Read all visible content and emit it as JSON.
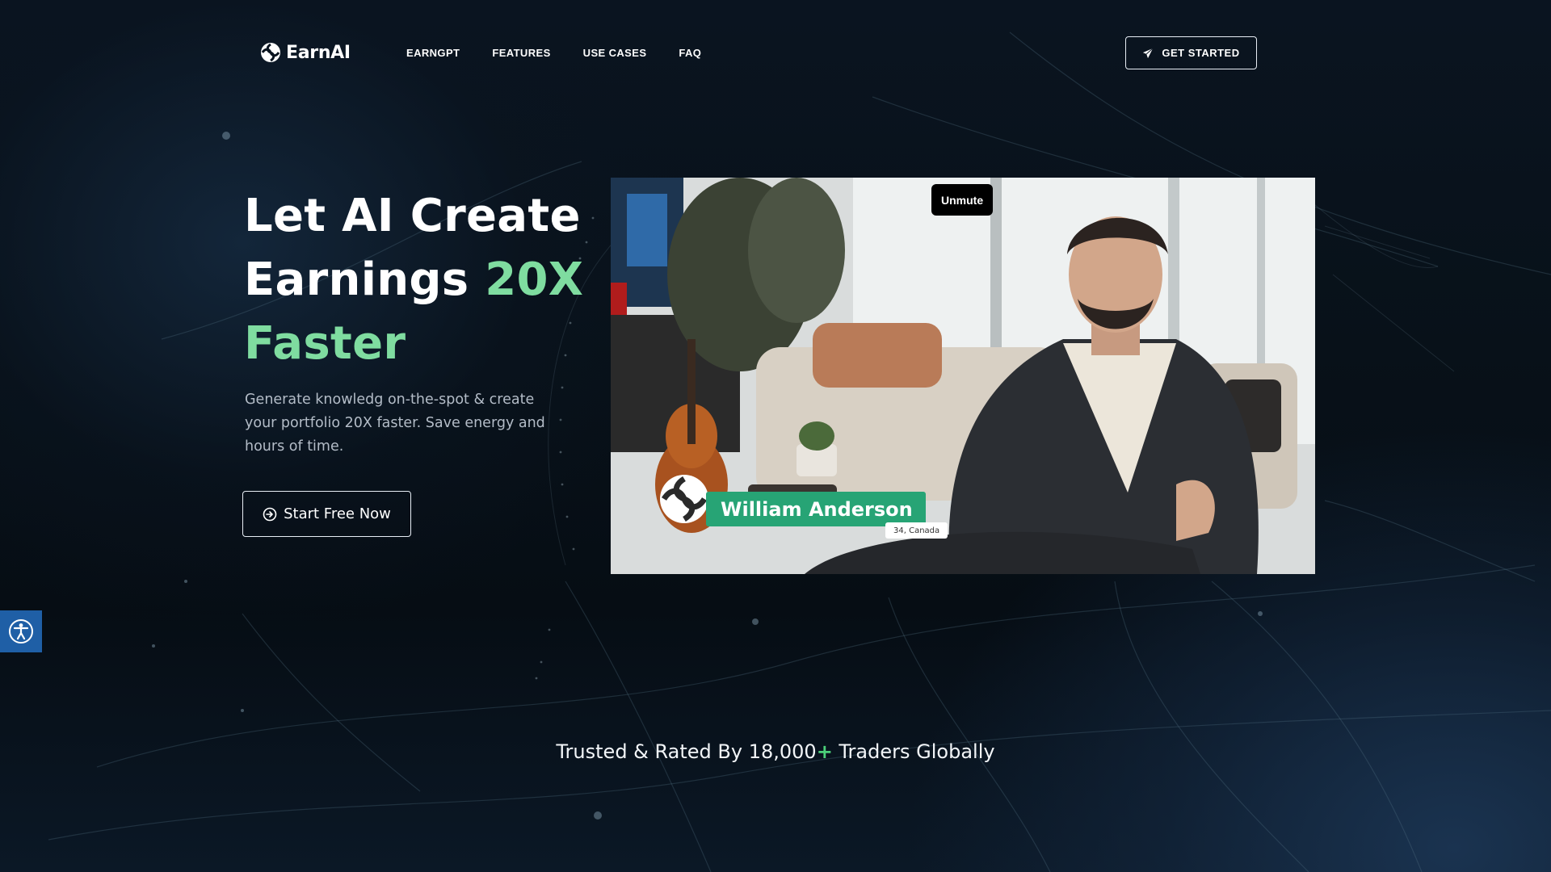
{
  "brand": {
    "name": "EarnAI",
    "accent_color": "#7fdca0"
  },
  "nav": {
    "items": [
      {
        "label": "EARNGPT"
      },
      {
        "label": "FEATURES"
      },
      {
        "label": "USE CASES"
      },
      {
        "label": "FAQ"
      }
    ],
    "cta_label": "GET STARTED",
    "cta_icon": "send-icon"
  },
  "hero": {
    "title_line1": "Let AI Create",
    "title_line2_a": "Earnings",
    "title_line2_b": "20X",
    "title_line3": "Faster",
    "description": "Generate knowledg on-the-spot & create your portfolio 20X faster. Save energy and hours of time.",
    "button_label": "Start Free Now",
    "button_icon": "arrow-circle-right-icon"
  },
  "video": {
    "unmute_label": "Unmute",
    "person_name": "William Anderson",
    "person_subtitle": "34, Canada",
    "name_tag_color": "#27a475"
  },
  "trusted": {
    "text_before": "Trusted & Rated By 18,000",
    "plus": "+",
    "text_after": " Traders Globally",
    "plus_color": "#4cd07a"
  },
  "accessibility": {
    "icon": "accessibility-icon",
    "color": "#1f5fa6"
  }
}
